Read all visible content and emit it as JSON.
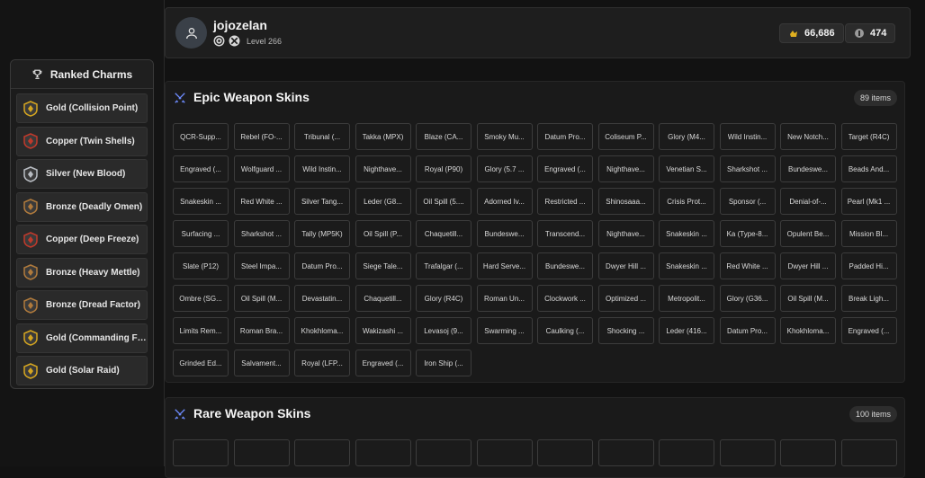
{
  "ranked_charms": {
    "title": "Ranked Charms",
    "items": [
      {
        "label": "Gold (Collision Point)",
        "tier": "gold"
      },
      {
        "label": "Copper (Twin Shells)",
        "tier": "copper"
      },
      {
        "label": "Silver (New Blood)",
        "tier": "silver"
      },
      {
        "label": "Bronze (Deadly Omen)",
        "tier": "bronze"
      },
      {
        "label": "Copper (Deep Freeze)",
        "tier": "copper"
      },
      {
        "label": "Bronze (Heavy Mettle)",
        "tier": "bronze"
      },
      {
        "label": "Bronze (Dread Factor)",
        "tier": "bronze"
      },
      {
        "label": "Gold (Commanding For...",
        "tier": "gold"
      },
      {
        "label": "Gold (Solar Raid)",
        "tier": "gold"
      }
    ]
  },
  "profile": {
    "username": "jojozelan",
    "level": "Level 266",
    "platform_icons": [
      "ubisoft-icon",
      "xbox-icon"
    ],
    "renown": "66,686",
    "credits": "474"
  },
  "colors": {
    "gold": "#d4a520",
    "silver": "#b8bcc2",
    "bronze": "#b07a3c",
    "copper": "#c0392b",
    "accent": "#6e8cff"
  },
  "epic": {
    "title": "Epic Weapon Skins",
    "count": "89 items",
    "items": [
      "QCR-Supp...",
      "Rebel (FO-...",
      "Tribunal (...",
      "Takka (MPX)",
      "Blaze (CA...",
      "Smoky Mu...",
      "Datum Pro...",
      "Coliseum P...",
      "Glory (M4...",
      "Wild Instin...",
      "New Notch...",
      "Target (R4C)",
      "Engraved (...",
      "Wolfguard ...",
      "Wild Instin...",
      "Nighthave...",
      "Royal (P90)",
      "Glory (5.7 ...",
      "Engraved (...",
      "Nighthave...",
      "Venetian S...",
      "Sharkshot ...",
      "Bundeswe...",
      "Beads And...",
      "Snakeskin ...",
      "Red White ...",
      "Silver Tang...",
      "Leder (G8...",
      "Oil Spill (5....",
      "Adorned Iv...",
      "Restricted ...",
      "Shinosaaa...",
      "Crisis Prot...",
      "Sponsor (...",
      "Denial-of-...",
      "Pearl (Mk1 ...",
      "Surfacing ...",
      "Sharkshot ...",
      "Tally (MP5K)",
      "Oil Spill (P...",
      "Chaquetill...",
      "Bundeswe...",
      "Transcend...",
      "Nighthave...",
      "Snakeskin ...",
      "Ka (Type-8...",
      "Opulent Be...",
      "Mission Bl...",
      "Slate (P12)",
      "Steel Impa...",
      "Datum Pro...",
      "Siege Tale...",
      "Trafalgar (...",
      "Hard Serve...",
      "Bundeswe...",
      "Dwyer Hill ...",
      "Snakeskin ...",
      "Red White ...",
      "Dwyer Hill ...",
      "Padded Hi...",
      "Ombre (SG...",
      "Oil Spill (M...",
      "Devastatin...",
      "Chaquetill...",
      "Glory (R4C)",
      "Roman Un...",
      "Clockwork ...",
      "Optimized ...",
      "Metropolit...",
      "Glory (G36...",
      "Oil Spill (M...",
      "Break Ligh...",
      "Limits Rem...",
      "Roman Bra...",
      "Khokhloma...",
      "Wakizashi ...",
      "Levasoj (9...",
      "Swarming ...",
      "Caulking (...",
      "Shocking ...",
      "Leder (416...",
      "Datum Pro...",
      "Khokhloma...",
      "Engraved (...",
      "Grinded Ed...",
      "Salvament...",
      "Royal (LFP...",
      "Engraved (...",
      "Iron Ship (..."
    ]
  },
  "rare": {
    "title": "Rare Weapon Skins",
    "count": "100 items"
  }
}
